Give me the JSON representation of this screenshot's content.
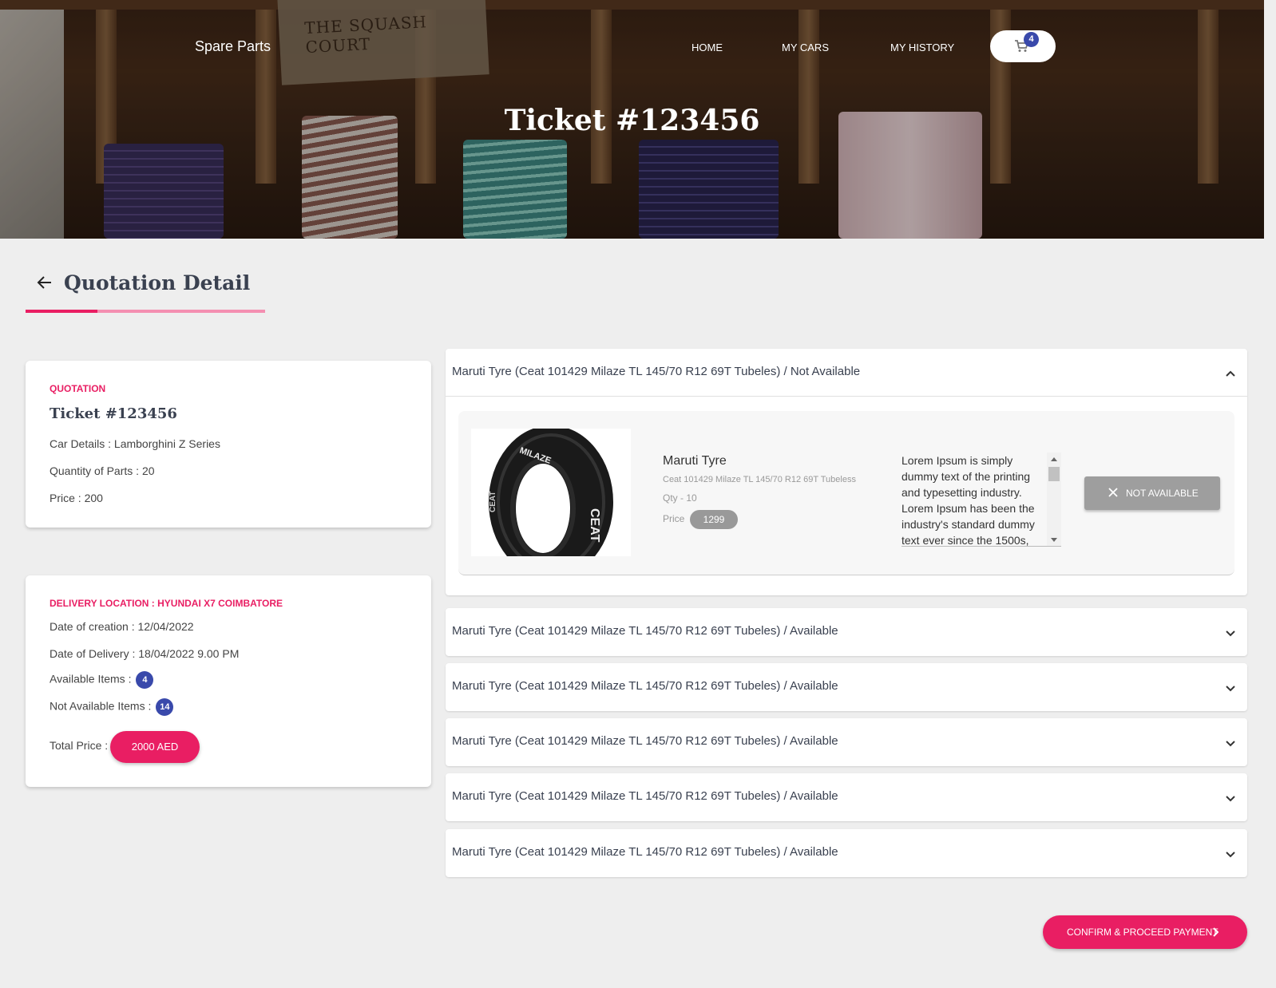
{
  "header": {
    "brand": "Spare Parts",
    "nav": [
      "HOME",
      "MY CARS",
      "MY HISTORY"
    ],
    "cart_count": "4",
    "hero_title": "Ticket #123456",
    "background_tag": "THE SQUASH COURT"
  },
  "section": {
    "title": "Quotation Detail"
  },
  "quotation_card": {
    "label": "QUOTATION",
    "ticket": "Ticket #123456",
    "car_details": "Car Details : Lamborghini Z Series",
    "quantity": "Quantity of Parts : 20",
    "price": "Price : 200"
  },
  "delivery_card": {
    "label": "DELIVERY LOCATION : HYUNDAI X7 COIMBATORE",
    "created": "Date of creation : 12/04/2022",
    "delivery": "Date of Delivery : 18/04/2022 9.00 PM",
    "available_label": "Available Items :",
    "available_count": "4",
    "not_available_label": "Not Available Items :",
    "not_available_count": "14",
    "total_label": "Total Price :",
    "total_value": "2000 AED"
  },
  "items": [
    {
      "title": "Maruti Tyre (Ceat 101429 Milaze TL 145/70 R12 69T Tubeles) / Not Available",
      "expanded": true,
      "name": "Maruti Tyre",
      "desc": "Ceat 101429 Milaze TL 145/70 R12 69T Tubeless",
      "qty": "Qty - 10",
      "price_label": "Price",
      "price": "1299",
      "lorem": "Lorem Ipsum is simply dummy text of the printing and typesetting industry. Lorem Ipsum has been the industry's standard dummy text ever since the 1500s,",
      "action": "NOT AVAILABLE",
      "tyre_brand": "CEAT",
      "tyre_model": "MILAZE"
    },
    {
      "title": "Maruti Tyre (Ceat 101429 Milaze TL 145/70 R12 69T Tubeles) / Available"
    },
    {
      "title": "Maruti Tyre (Ceat 101429 Milaze TL 145/70 R12 69T Tubeles) / Available"
    },
    {
      "title": "Maruti Tyre (Ceat 101429 Milaze TL 145/70 R12 69T Tubeles) / Available"
    },
    {
      "title": "Maruti Tyre (Ceat 101429 Milaze TL 145/70 R12 69T Tubeles) / Available"
    },
    {
      "title": "Maruti Tyre (Ceat 101429 Milaze TL 145/70 R12 69T Tubeles) / Available"
    }
  ],
  "confirm_label": "CONFIRM & PROCEED PAYMENT",
  "colors": {
    "accent": "#e91e63",
    "badge": "#3949ab",
    "muted_button": "#9e9e9e"
  }
}
